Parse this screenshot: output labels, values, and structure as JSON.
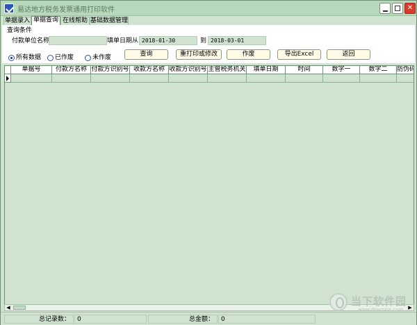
{
  "window": {
    "title": "易达地方税务发票通用打印软件"
  },
  "tabs": [
    {
      "label": "单据录入"
    },
    {
      "label": "单据查询"
    },
    {
      "label": "在线帮助"
    },
    {
      "label": "基础数据管理"
    }
  ],
  "query": {
    "group_label": "查询条件",
    "payer_label": "付款单位名称",
    "payer_value": "",
    "date_from_label": "填单日期从",
    "date_from_value": "2018-01-30",
    "date_to_label": "到",
    "date_to_value": "2018-03-01",
    "radio_all": "所有数据",
    "radio_voided": "已作废",
    "radio_not_voided": "未作废",
    "selected_radio": "所有数据",
    "buttons": {
      "query": "查询",
      "reprint": "重打印或修改",
      "void": "作废",
      "export": "导出Excel",
      "back": "返回"
    }
  },
  "grid": {
    "columns": [
      "单据号",
      "付款方名称",
      "付款方识别号",
      "收款方名称",
      "收款方识别号",
      "主管税务机关",
      "填单日期",
      "时间",
      "数字一",
      "数字二",
      "防伪码"
    ]
  },
  "status": {
    "record_count_label": "总记录数：",
    "record_count_value": "0",
    "total_amount_label": "总金额：",
    "total_amount_value": "0"
  },
  "watermark": {
    "text": "当下软件园",
    "url": "www.downxia.com"
  },
  "colors": {
    "grid_background": "#cfe3d0",
    "button_background": "#fffbe6",
    "close_button": "#d93a2c"
  }
}
